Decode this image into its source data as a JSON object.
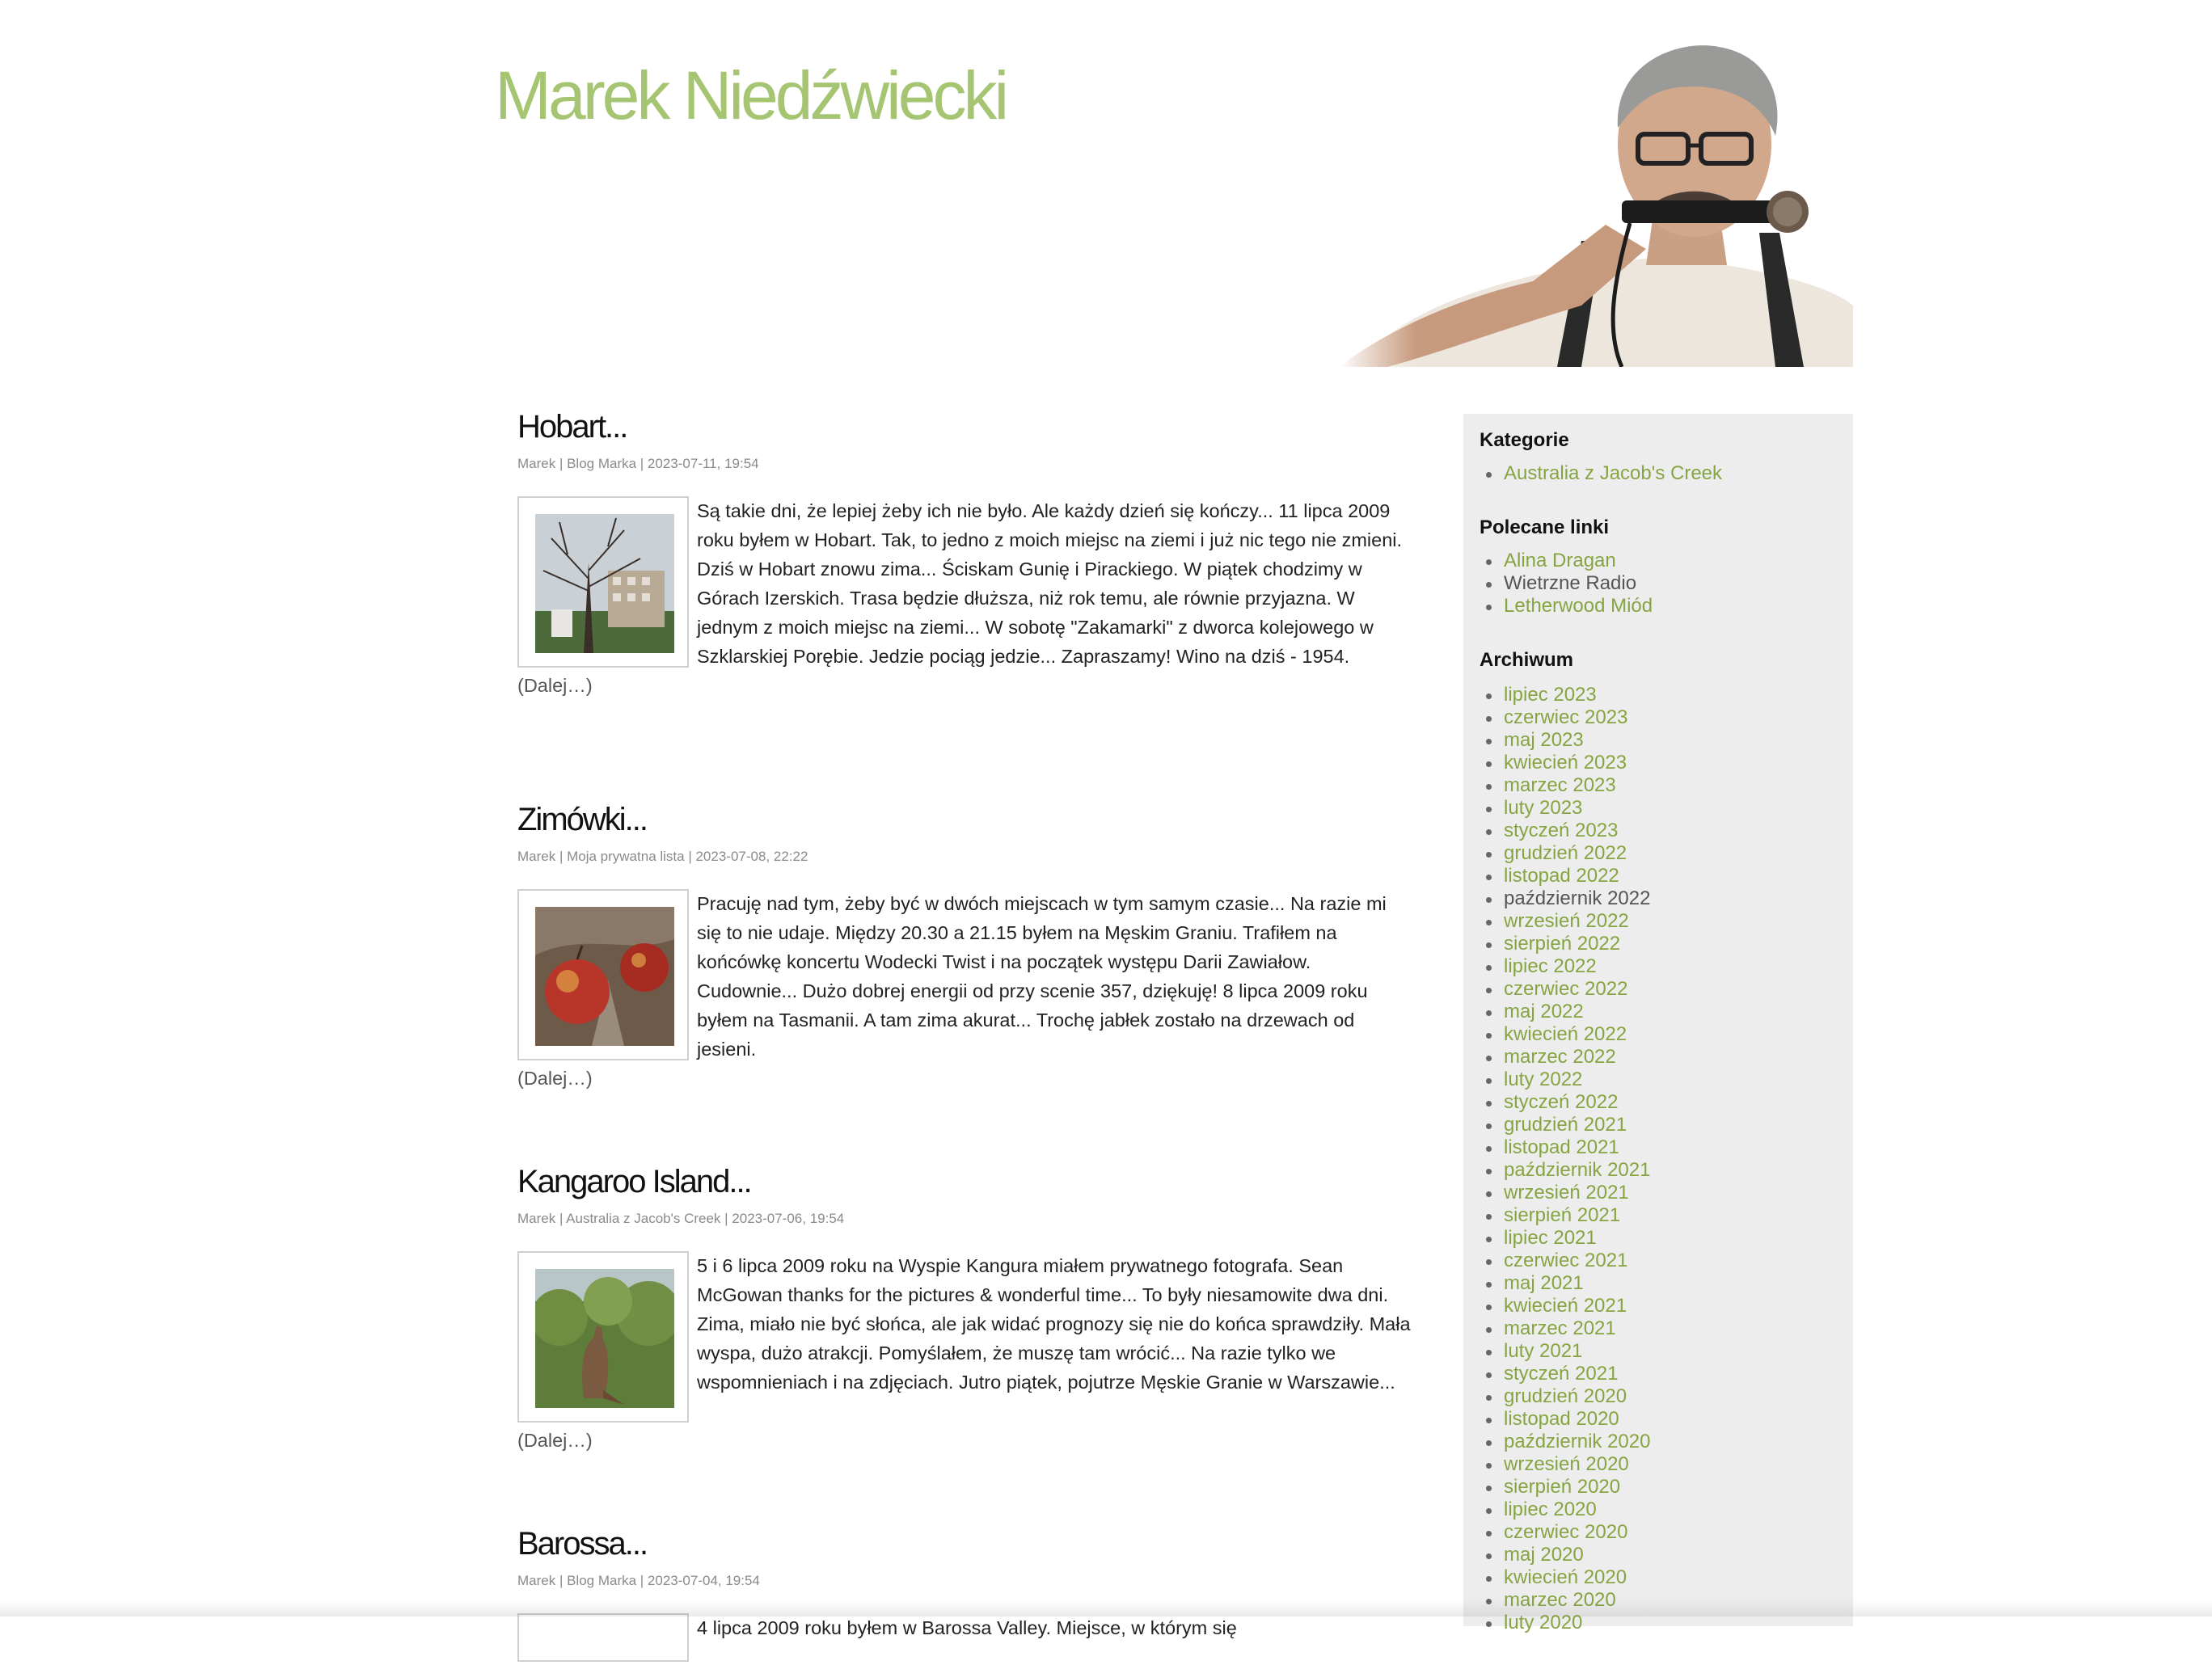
{
  "site": {
    "title": "Marek Niedźwiecki"
  },
  "posts": [
    {
      "title": "Hobart...",
      "meta": "Marek | Blog Marka | 2023-07-11, 19:54",
      "excerpt": "Są takie dni, że lepiej żeby ich nie było. Ale każdy dzień się kończy... 11 lipca 2009 roku byłem w Hobart. Tak, to jedno z moich miejsc na ziemi i już nic tego nie zmieni. Dziś w Hobart znowu zima... Ściskam Gunię i Pirackiego. W piątek chodzimy w Górach Izerskich. Trasa będzie dłuższa, niż rok temu, ale równie przyjazna. W jednym z moich miejsc na ziemi... W sobotę \"Zakamarki\" z dworca kolejowego w Szklarskiej Porębie. Jedzie pociąg jedzie... Zapraszamy! Wino na dziś - 1954.",
      "more": "(Dalej…)"
    },
    {
      "title": "Zimówki...",
      "meta": "Marek | Moja prywatna lista | 2023-07-08, 22:22",
      "excerpt": "Pracuję nad tym, żeby być w dwóch miejscach w tym samym czasie... Na razie mi się to nie udaje. Między 20.30 a 21.15 byłem na Męskim Graniu. Trafiłem na końcówkę koncertu Wodecki Twist i na początek występu Darii Zawiałow. Cudownie... Dużo dobrej energii od przy scenie 357, dziękuję! 8 lipca 2009 roku byłem na Tasmanii. A tam zima akurat... Trochę jabłek zostało na drzewach od jesieni.",
      "more": "(Dalej…)"
    },
    {
      "title": "Kangaroo Island...",
      "meta": "Marek | Australia z Jacob's Creek | 2023-07-06, 19:54",
      "excerpt": "5 i 6 lipca 2009 roku na Wyspie Kangura miałem prywatnego fotografa. Sean McGowan thanks for the pictures & wonderful time... To były niesamowite dwa dni. Zima, miało nie być słońca, ale jak widać prognozy się nie do końca sprawdziły. Mała wyspa, dużo atrakcji. Pomyślałem, że muszę tam wrócić... Na razie tylko we wspomnieniach i na zdjęciach. Jutro piątek, pojutrze Męskie Granie w Warszawie...",
      "more": "(Dalej…)"
    },
    {
      "title": "Barossa...",
      "meta": "Marek | Blog Marka | 2023-07-04, 19:54",
      "excerpt": "4 lipca 2009 roku byłem w Barossa Valley. Miejsce, w którym się",
      "more": ""
    }
  ],
  "sidebar": {
    "categories": {
      "heading": "Kategorie",
      "items": [
        "Australia z Jacob's Creek"
      ]
    },
    "links": {
      "heading": "Polecane linki",
      "items": [
        "Alina Dragan",
        "Wietrzne Radio",
        "Letherwood Miód"
      ]
    },
    "archive": {
      "heading": "Archiwum",
      "items": [
        "lipiec 2023",
        "czerwiec 2023",
        "maj 2023",
        "kwiecień 2023",
        "marzec 2023",
        "luty 2023",
        "styczeń 2023",
        "grudzień 2022",
        "listopad 2022",
        "październik 2022",
        "wrzesień 2022",
        "sierpień 2022",
        "lipiec 2022",
        "czerwiec 2022",
        "maj 2022",
        "kwiecień 2022",
        "marzec 2022",
        "luty 2022",
        "styczeń 2022",
        "grudzień 2021",
        "listopad 2021",
        "październik 2021",
        "wrzesień 2021",
        "sierpień 2021",
        "lipiec 2021",
        "czerwiec 2021",
        "maj 2021",
        "kwiecień 2021",
        "marzec 2021",
        "luty 2021",
        "styczeń 2021",
        "grudzień 2020",
        "listopad 2020",
        "październik 2020",
        "wrzesień 2020",
        "sierpień 2020",
        "lipiec 2020",
        "czerwiec 2020",
        "maj 2020",
        "kwiecień 2020",
        "marzec 2020",
        "luty 2020"
      ]
    }
  },
  "colors": {
    "accent": "#86a542",
    "title": "#a6c573",
    "sidebar_bg": "#ededed"
  }
}
